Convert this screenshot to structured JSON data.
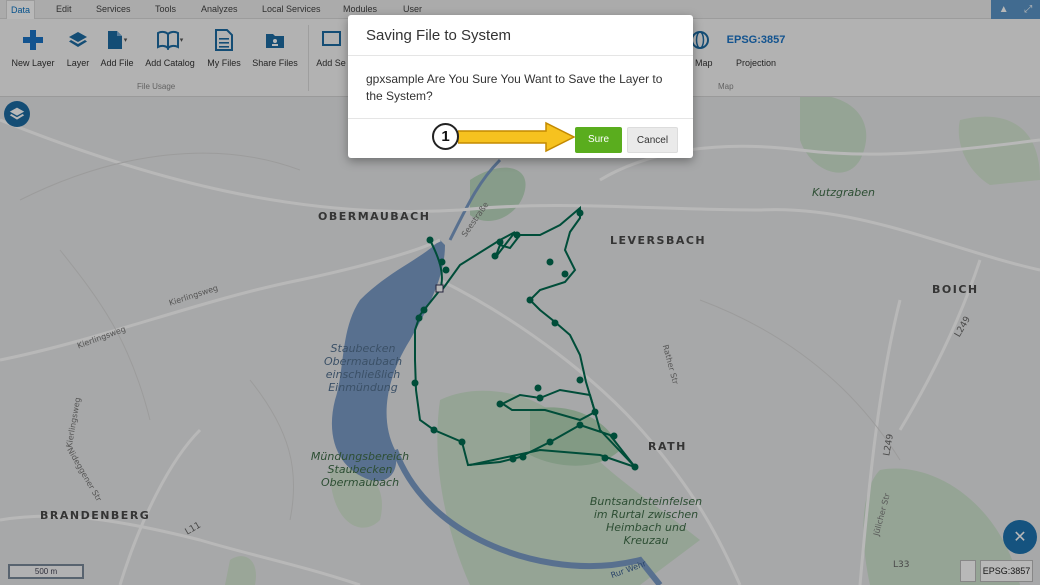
{
  "tabs": [
    "Data",
    "Edit",
    "Services",
    "Tools",
    "Analyzes",
    "Local Services",
    "Modules",
    "User"
  ],
  "toolbar": {
    "new_layer": "New Layer",
    "layer": "Layer",
    "add_file": "Add File",
    "add_catalog": "Add Catalog",
    "my_files": "My Files",
    "share_files": "Share Files",
    "add_service": "Add Se",
    "file_usage_group": "File Usage",
    "map_group": "Map",
    "save_map": "e Map",
    "epsg_label": "EPSG:3857",
    "projection": "Projection"
  },
  "dialog": {
    "title": "Saving File to System",
    "message": "gpxsample Are You Sure You Want to Save the Layer to the System?",
    "sure_label": "Sure",
    "cancel_label": "Cancel"
  },
  "annotation": {
    "step": "1"
  },
  "map_labels": {
    "obermaubach": "OBERMAUBACH",
    "leversbach": "LEVERSBACH",
    "boich": "BOICH",
    "rath": "RATH",
    "brandenberg": "BRANDENBERG",
    "kutzgraben": "Kutzgraben",
    "staubecken1": "Staubecken Obermaubach einschließlich Einmündung",
    "staubecken2": "Mündungsbereich Staubecken Obermaubach",
    "buntsandstein": "Buntsandsteinfelsen im Rurtal zwischen Heimbach und Kreuzau",
    "seestrasse": "Seestraße",
    "kierlingsweg1": "Kierlingsweg",
    "kierlingsweg2": "Kierlingsweg",
    "kierlingsweg3": "Kierlingsweg",
    "nideggener": "Nideggener Str",
    "rather": "Rather Str",
    "juelicher": "Jülicher Str",
    "rurwehr": "Rur Wehr",
    "l249": "L249",
    "l249b": "L249",
    "l11": "L11",
    "l33": "L33"
  },
  "scale": "500 m",
  "projection_status": "EPSG:3857",
  "colors": {
    "accent": "#0a72c2",
    "sure": "#5aad1e",
    "track": "#006b4f",
    "arrow": "#f6c21f"
  }
}
